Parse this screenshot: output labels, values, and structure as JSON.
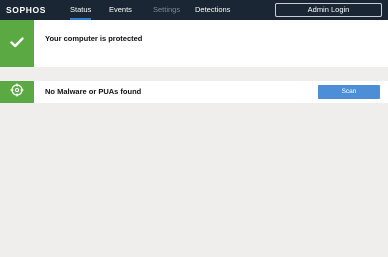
{
  "header": {
    "logo": "SOPHOS",
    "tabs": [
      {
        "label": "Status",
        "active": true,
        "enabled": true
      },
      {
        "label": "Events",
        "active": false,
        "enabled": true
      },
      {
        "label": "Settings",
        "active": false,
        "enabled": false
      },
      {
        "label": "Detections",
        "active": false,
        "enabled": true
      }
    ],
    "admin_login_label": "Admin Login"
  },
  "protection": {
    "title": "Your computer is protected",
    "icon": "checkmark-icon"
  },
  "scan": {
    "title": "No Malware or PUAs found",
    "icon": "crosshair-icon",
    "button_label": "Scan"
  },
  "colors": {
    "header_bg": "#1a2633",
    "status_green": "#5aa942",
    "accent_blue": "#4d8fd6",
    "tab_underline": "#2f7fd1",
    "page_bg": "#efeeec"
  }
}
